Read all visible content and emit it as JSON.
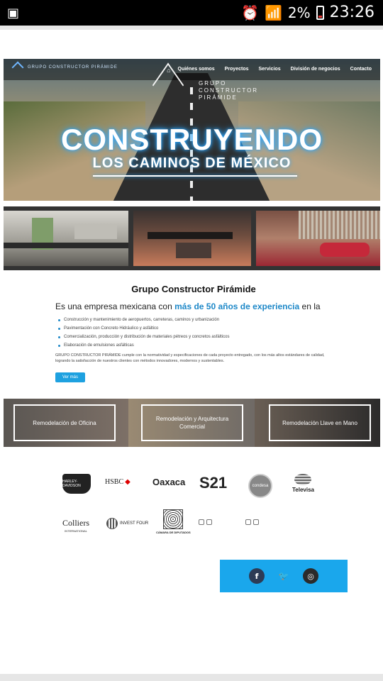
{
  "status": {
    "left_icon": "notification-icon",
    "battery": "2%",
    "time": "23:26"
  },
  "nav": {
    "logo_small_text": "GRUPO CONSTRUCTOR PIRÁMIDE",
    "items": [
      "Quiénes somos",
      "Proyectos",
      "Servicios",
      "División de negocios",
      "Contacto"
    ]
  },
  "hero": {
    "logo_text": "GRUPO CONSTRUCTOR PIRÁMIDE",
    "headline": "CONSTRUYENDO",
    "subheadline": "LOS CAMINOS DE MÉXICO"
  },
  "about": {
    "title": "Grupo Constructor Pirámide",
    "intro_prefix": "Es una empresa mexicana con ",
    "intro_highlight": "más de 50 años de experiencia",
    "intro_suffix": " en la",
    "bullets": [
      "Construcción y mantenimiento de aeropuertos, carreteras, caminos y urbanización",
      "Pavimentación con Concreto Hidráulico y asfáltico",
      "Comercialización, producción y distribución de materiales pétreos y concretos asfálticos",
      "Elaboración de emulsiones asfálticas"
    ],
    "paragraph": "GRUPO CONSTRUCTOR PIRÁMIDE cumple con la normatividad y especificaciones de cada proyecto entregado, con los más altos estándares de calidad, logrando la satisfacción de nuestros clientes con métodos innovadores, modernos y sustentables.",
    "button": "Ver más"
  },
  "services": [
    "Remodelación de Oficina",
    "Remodelación y Arquitectura Comercial",
    "Remodelación Llave en Mano"
  ],
  "clients": {
    "harley": "HARLEY-DAVIDSON",
    "hsbc": "HSBC",
    "oaxaca": "Oaxaca",
    "s21": "S21",
    "condesa": "condesa",
    "televisa": "Televisa",
    "colliers": "Colliers",
    "colliers_sub": "INTERNATIONAL",
    "invest": "INVEST FOUR",
    "camara": "CÁMARA DE DIPUTADOS"
  },
  "social": [
    "facebook-icon",
    "twitter-icon",
    "instagram-icon"
  ],
  "colors": {
    "accent": "#1aa7ec",
    "highlight": "#1e88c8"
  }
}
